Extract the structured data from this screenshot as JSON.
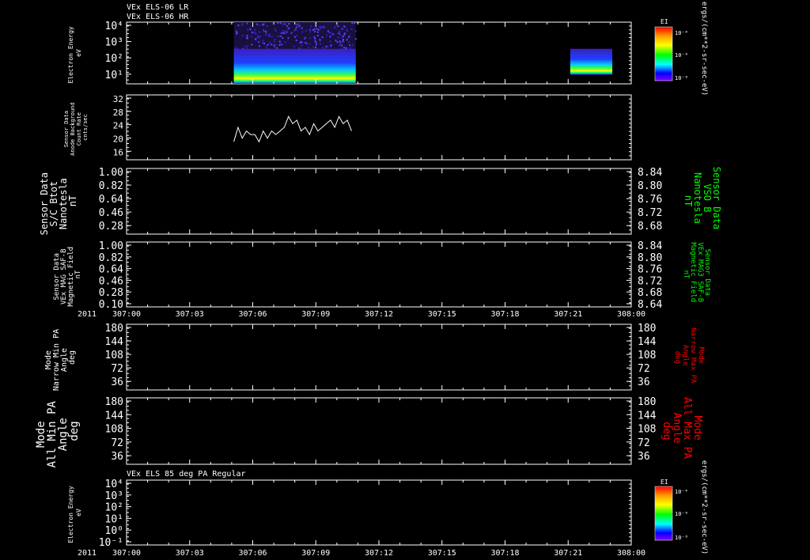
{
  "titles": [
    "VEx ELS-06 LR",
    "VEx ELS-06 HR"
  ],
  "colorbar": {
    "title": "EI",
    "units": "ergs/(cm**2-sr-sec-eV)",
    "ticks": [
      "10⁻⁴",
      "10⁻⁶",
      "10⁻⁸"
    ],
    "colors": [
      "#ff0000",
      "#ffa500",
      "#ffff00",
      "#00ff00",
      "#00ffff",
      "#0000ff",
      "#8000ff"
    ]
  },
  "panels": [
    {
      "id": "electron-energy-hr",
      "left_label": [
        "Electron Energy",
        "eV"
      ],
      "left_label_color": "#ffffff",
      "y_scale": "log",
      "y_ticks": [
        "10⁴",
        "10³",
        "10²",
        "10¹"
      ]
    },
    {
      "id": "anode-background",
      "left_label": [
        "Sensor Data",
        "Anode Background",
        "Count Rate",
        "cnts/sec"
      ],
      "left_label_color": "#ffffff",
      "y_ticks": [
        "32",
        "28",
        "24",
        "20",
        "16"
      ]
    },
    {
      "id": "sc-btot",
      "left_label": [
        "Sensor Data",
        "S/C Btot",
        "Nanotesla",
        "nT"
      ],
      "left_label_color": "#ffffff",
      "y_ticks": [
        "1.00",
        "0.82",
        "0.64",
        "0.46",
        "0.28"
      ],
      "right_label": [
        "Sensor Data",
        "VSO B",
        "Nanotesla",
        "nT"
      ],
      "right_label_color": "#00ff00",
      "right_ticks": [
        "8.84",
        "8.80",
        "8.76",
        "8.72",
        "8.68"
      ]
    },
    {
      "id": "mag-saf-b",
      "left_label": [
        "Sensor Data",
        "VEx MAG SAF-B",
        "Magnetic Field",
        "nT"
      ],
      "left_label_color": "#ffffff",
      "y_ticks": [
        "1.00",
        "0.82",
        "0.64",
        "0.46",
        "0.28",
        "0.10"
      ],
      "right_label": [
        "Sensor Data",
        "VEx MAG3 SAF-B",
        "Magnetic Field",
        "nT"
      ],
      "right_label_color": "#00ff00",
      "right_ticks": [
        "8.84",
        "8.80",
        "8.76",
        "8.72",
        "8.68",
        "8.64"
      ]
    },
    {
      "id": "narrow-pa",
      "left_label": [
        "Mode",
        "Narrow Min PA",
        "Angle",
        "deg"
      ],
      "left_label_color": "#ffffff",
      "y_ticks": [
        "180",
        "144",
        "108",
        "72",
        "36"
      ],
      "right_label": [
        "Mode",
        "Narrow Max PA",
        "Angle",
        "deg"
      ],
      "right_label_color": "#ff0000",
      "right_ticks": [
        "180",
        "144",
        "108",
        "72",
        "36"
      ]
    },
    {
      "id": "all-pa",
      "left_label": [
        "Mode",
        "All Min PA",
        "Angle",
        "deg"
      ],
      "left_label_color": "#ffffff",
      "y_ticks": [
        "180",
        "144",
        "108",
        "72",
        "36"
      ],
      "right_label": [
        "Mode",
        "All Max PA",
        "Angle",
        "deg"
      ],
      "right_label_color": "#ff0000",
      "right_ticks": [
        "180",
        "144",
        "108",
        "72",
        "36"
      ]
    },
    {
      "id": "electron-energy-85",
      "title": "VEx ELS 85 deg PA Regular",
      "left_label": [
        "Electron Energy",
        "eV"
      ],
      "left_label_color": "#ffffff",
      "y_scale": "log",
      "y_ticks": [
        "10⁴",
        "10³",
        "10²",
        "10¹",
        "10⁰",
        "10⁻¹"
      ]
    }
  ],
  "x_axis": {
    "year": "2011",
    "labels": [
      "307:00",
      "307:03",
      "307:06",
      "307:09",
      "307:12",
      "307:15",
      "307:18",
      "307:21",
      "308:00"
    ]
  },
  "chart_data": {
    "type": "line",
    "title": "VEx ELS-06 HR",
    "x_unit": "day-of-year:hour",
    "series": [
      {
        "name": "Anode Background",
        "x": [
          5.1,
          5.3,
          5.5,
          5.7,
          5.9,
          6.1,
          6.3,
          6.5,
          6.7,
          6.9,
          7.1,
          7.3,
          7.5,
          7.7,
          7.9,
          8.1,
          8.3,
          8.5,
          8.7,
          8.9,
          9.1,
          9.3,
          9.5,
          9.7,
          9.9,
          10.1,
          10.3,
          10.5,
          10.7
        ],
        "values": [
          19,
          23,
          20,
          22,
          21,
          21,
          19,
          22,
          20,
          22,
          21,
          22,
          23,
          26,
          24,
          25,
          22,
          23,
          21,
          24,
          22,
          23,
          24,
          25,
          23,
          26,
          24,
          25,
          22
        ]
      }
    ],
    "ylim": [
      14,
      32
    ],
    "xlim": [
      0,
      24
    ],
    "spectrogram": {
      "x_ranges": [
        [
          5.1,
          10.9
        ],
        [
          21.1,
          23.1
        ]
      ],
      "energy_range_eV": [
        3,
        10000
      ]
    }
  }
}
